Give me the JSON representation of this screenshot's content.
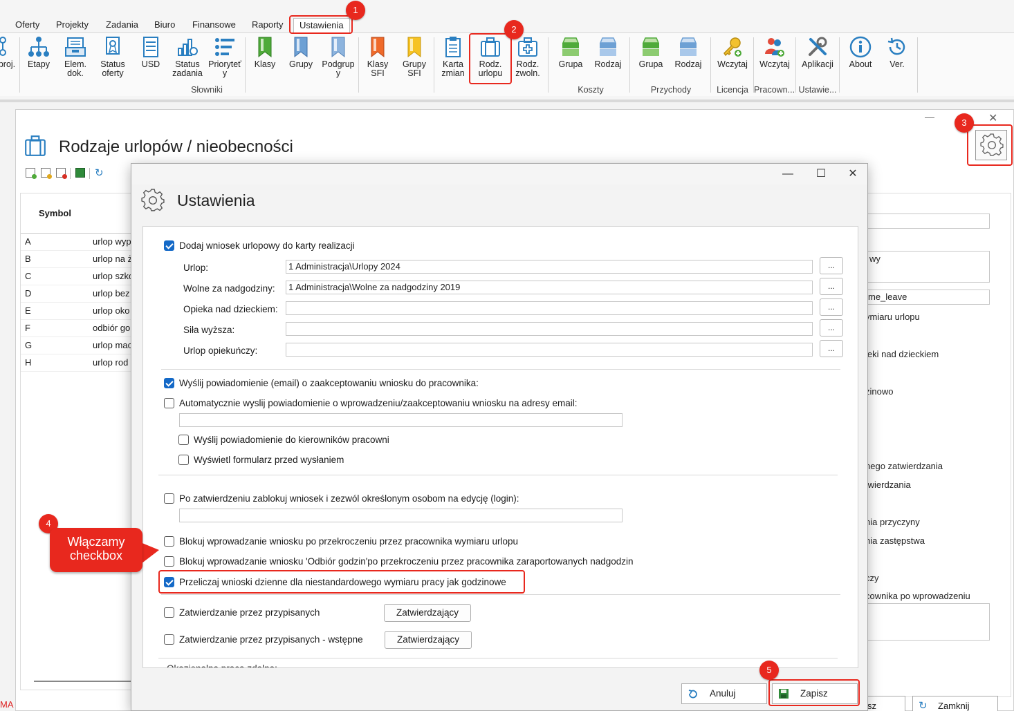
{
  "menu": {
    "tabs": [
      "Oferty",
      "Projekty",
      "Zadania",
      "Biuro",
      "Finansowe",
      "Raporty",
      "Ustawienia"
    ],
    "active": "Ustawienia"
  },
  "ribbon": {
    "buttons": {
      "proj": "proj.",
      "etapy": "Etapy",
      "elem": "Elem. dok.",
      "status_oferty": "Status oferty",
      "usd": "USD",
      "status_zadania": "Status zadania",
      "priorytet": "Prioryteť y",
      "klasy": "Klasy",
      "grupy": "Grupy",
      "podgrupy": "Podgrup y",
      "klasy_sfi": "Klasy SFI",
      "grupy_sfi": "Grupy SFI",
      "karta_zmian": "Karta zmian",
      "rodz_urlopu": "Rodz. urlopu",
      "rodz_zwoln": "Rodz. zwoln.",
      "koszty_grupa": "Grupa",
      "koszty_rodzaj": "Rodzaj",
      "przychody_grupa": "Grupa",
      "przychody_rodzaj": "Rodzaj",
      "wczytaj_licencja": "Wczytaj",
      "wczytaj_pracown": "Wczytaj",
      "aplikacji": "Aplikacji",
      "about": "About",
      "ver": "Ver."
    },
    "groups": {
      "slowniki": "Słowniki",
      "koszty": "Koszty",
      "przychody": "Przychody",
      "licencja": "Licencja",
      "pracown": "Pracown...",
      "ustawie": "Ustawie..."
    }
  },
  "markers": [
    "1",
    "2",
    "3",
    "4",
    "5"
  ],
  "background_window": {
    "title": "Rodzaje urlopów / nieobecności",
    "grid_header": "Symbol",
    "rows": [
      {
        "symbol": "A",
        "name": "urlop wyp"
      },
      {
        "symbol": "B",
        "name": "urlop na ż"
      },
      {
        "symbol": "C",
        "name": "urlop szko"
      },
      {
        "symbol": "D",
        "name": "urlop bez"
      },
      {
        "symbol": "E",
        "name": "urlop oko"
      },
      {
        "symbol": "F",
        "name": "odbiór go"
      },
      {
        "symbol": "G",
        "name": "urlop mac"
      },
      {
        "symbol": "H",
        "name": "urlop rod"
      }
    ],
    "right_texts": {
      "t1": "wy",
      "t2": "me_leave",
      "t3": "ymiaru urlopu",
      "t4": "ieki nad dzieckiem",
      "t5": "zinowo",
      "t6": "nego zatwierdzania",
      "t7": "twierdzania",
      "t8": "nia przyczyny",
      "t9": "nia zastępstwa",
      "t10": "czy",
      "t11": "cownika po wprowadzeniu"
    },
    "status_left": "MA",
    "btn_partial": "sz",
    "close_button": "Zamknij"
  },
  "dialog": {
    "title": "Ustawienia",
    "add_to_card": {
      "label": "Dodaj wniosek urlopowy do karty realizacji",
      "checked": true
    },
    "fields": [
      {
        "label": "Urlop:",
        "value": "1 Administracja\\Urlopy 2024",
        "button": "..."
      },
      {
        "label": "Wolne za nadgodziny:",
        "value": "1 Administracja\\Wolne za nadgodziny 2019",
        "button": "..."
      },
      {
        "label": "Opieka nad dzieckiem:",
        "value": "",
        "button": "..."
      },
      {
        "label": "Siła wyższa:",
        "value": "",
        "button": "..."
      },
      {
        "label": "Urlop opiekuńczy:",
        "value": "",
        "button": "..."
      }
    ],
    "send_notification": {
      "label": "Wyślij powiadomienie (email) o zaakceptowaniu wniosku do pracownika:",
      "checked": true
    },
    "auto_notification": {
      "label": "Automatycznie wyslij powiadomienie o wprowadzeniu/zaakceptowaniu wniosku na adresy email:",
      "checked": false
    },
    "notify_managers": {
      "label": "Wyślij powiadomienie do kierowników pracowni",
      "checked": false
    },
    "show_form": {
      "label": "Wyświetl formularz przed wysłaniem",
      "checked": false
    },
    "lock_after_approval": {
      "label": "Po zatwierdzeniu zablokuj wniosek i zezwól określonym osobom na edycję (login):",
      "checked": false
    },
    "block_exceed_leave": {
      "label": "Blokuj wprowadzanie wniosku po przekroczeniu przez pracownika wymiaru urlopu",
      "checked": false
    },
    "block_exceed_hours": {
      "label": "Blokuj wprowadzanie wniosku 'Odbiór godzin'po przekroczeniu przez pracownika zaraportowanych nadgodzin",
      "checked": false
    },
    "recalc_daily": {
      "label": "Przeliczaj wnioski dzienne dla niestandardowego wymiaru pracy jak godzinowe",
      "checked": true
    },
    "approve_assigned": {
      "label": "Zatwierdzanie przez przypisanych",
      "checked": false,
      "button": "Zatwierdzający"
    },
    "approve_assigned_pre": {
      "label": "Zatwierdzanie przez przypisanych - wstępne",
      "checked": false,
      "button": "Zatwierdzający"
    },
    "cut_text": "Okazjonalna praca zdalna:",
    "cancel_button": "Anuluj",
    "save_button": "Zapisz"
  },
  "callout": {
    "line1": "Włączamy",
    "line2": "checkbox"
  },
  "colors": {
    "accent_red": "#e8281e",
    "check_blue": "#1469c7"
  }
}
